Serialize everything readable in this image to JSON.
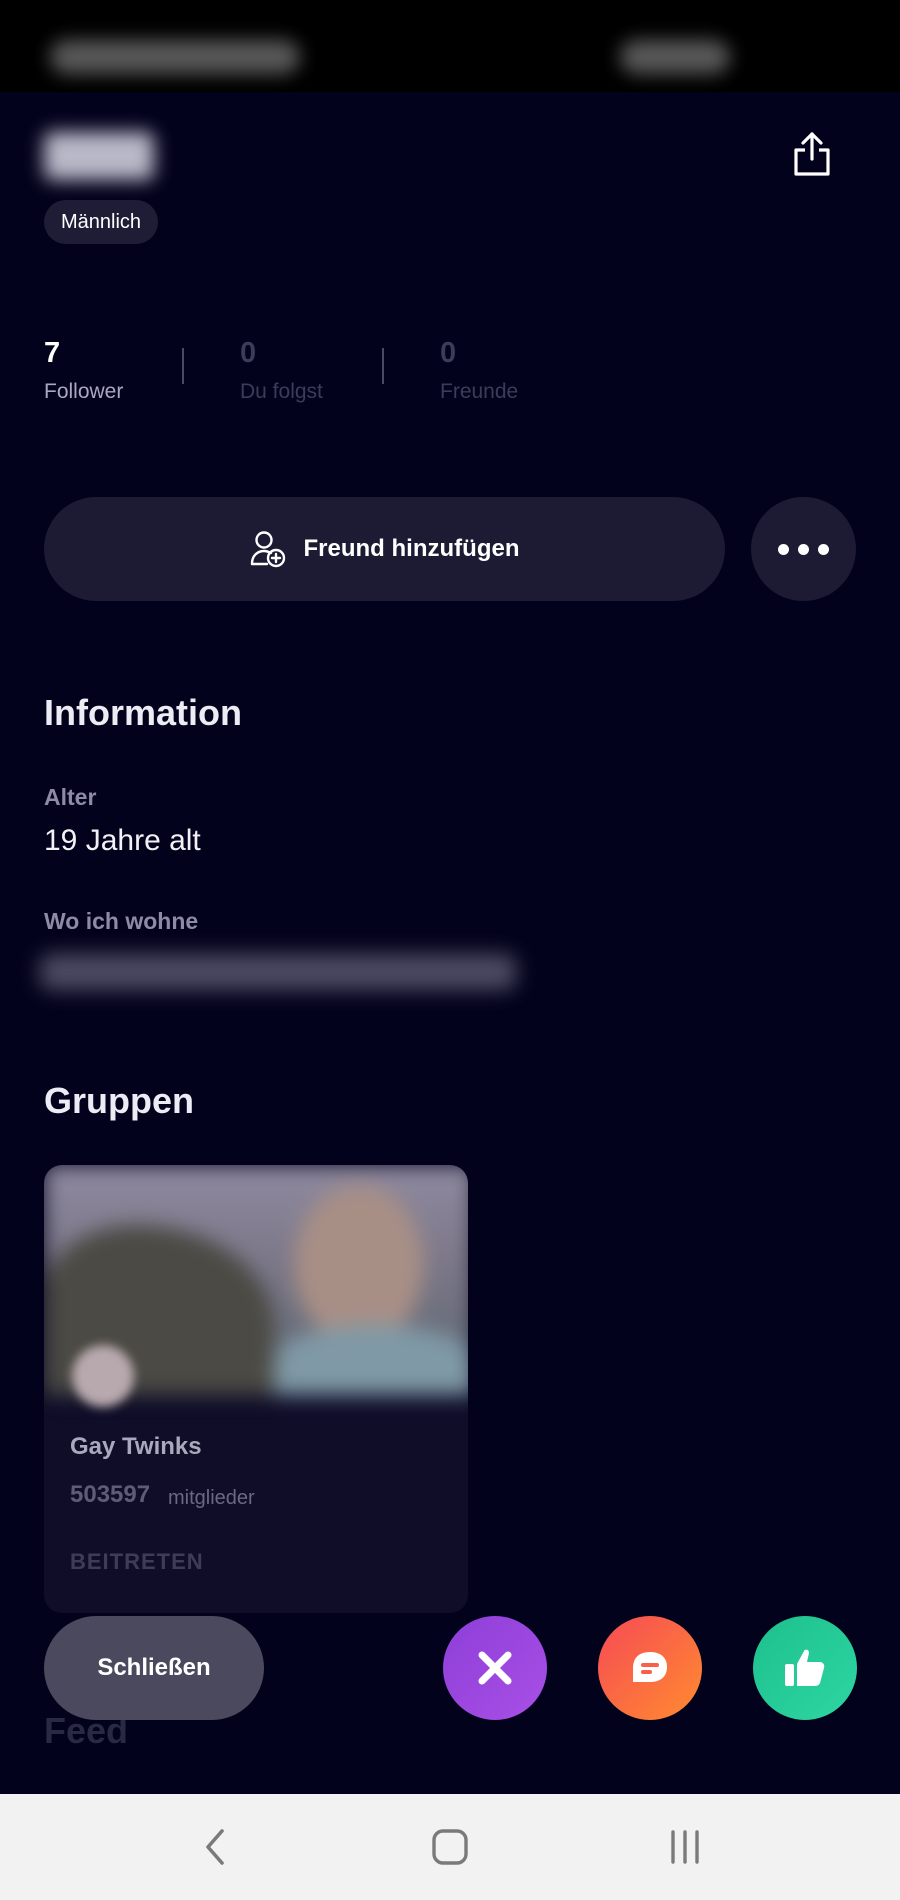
{
  "profile": {
    "gender": "Männlich"
  },
  "stats": [
    {
      "value": "7",
      "label": "Follower"
    },
    {
      "value": "0",
      "label": "Du folgst"
    },
    {
      "value": "0",
      "label": "Freunde"
    }
  ],
  "actions": {
    "add_friend_label": "Freund hinzufügen",
    "more_icon": "more-horizontal-icon"
  },
  "information": {
    "title": "Information",
    "age_label": "Alter",
    "age_value": "19 Jahre alt",
    "location_label": "Wo ich wohne"
  },
  "groups": {
    "title": "Gruppen",
    "items": [
      {
        "name": "Gay Twinks",
        "count": "503597",
        "members_label": "mitglieder",
        "join_label": "BEITRETEN"
      }
    ]
  },
  "feed": {
    "title": "Feed"
  },
  "bottom_actions": {
    "close_label": "Schließen",
    "dismiss_icon": "close-icon",
    "message_icon": "message-icon",
    "like_icon": "thumbs-up-icon"
  },
  "navigation": {
    "icons": [
      "back-icon",
      "home-icon",
      "recent-apps-icon"
    ]
  },
  "colors": {
    "background": "#03021c",
    "button_surface": "#1d1b33",
    "dismiss": "#9b46df",
    "message": "#f8604a",
    "like": "#25cb97"
  }
}
